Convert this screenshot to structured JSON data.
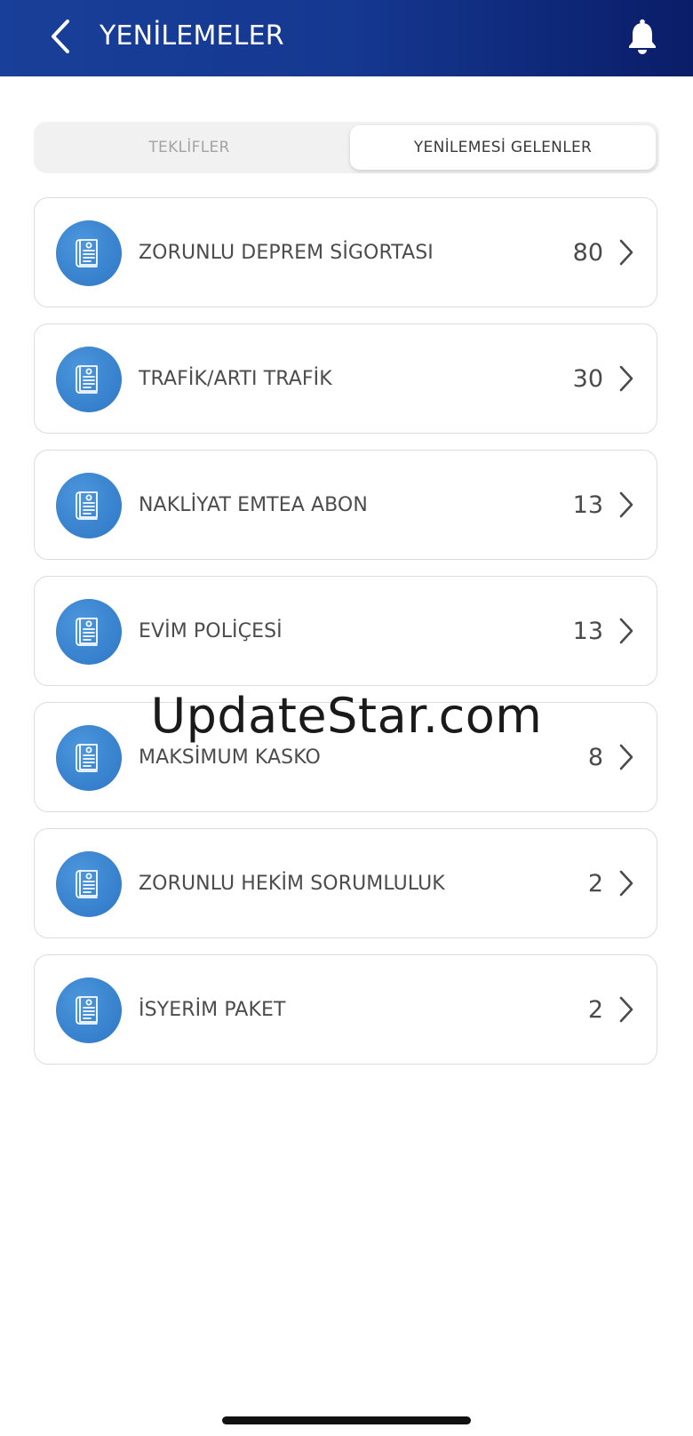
{
  "header": {
    "title": "YENİLEMELER",
    "back_icon": "chevron-left-icon",
    "bell_icon": "bell-icon",
    "background": "#163a92"
  },
  "tabs": [
    {
      "label": "TEKLİFLER",
      "active": false
    },
    {
      "label": "YENİLEMESİ GELENLER",
      "active": true
    }
  ],
  "items": [
    {
      "label": "ZORUNLU DEPREM SİGORTASI",
      "count": "80"
    },
    {
      "label": "TRAFİK/ARTI TRAFİK",
      "count": "30"
    },
    {
      "label": "NAKLİYAT EMTEA ABON",
      "count": "13"
    },
    {
      "label": "EVİM POLİÇESİ",
      "count": "13"
    },
    {
      "label": "MAKSİMUM KASKO",
      "count": "8"
    },
    {
      "label": "ZORUNLU HEKİM SORUMLULUK",
      "count": "2"
    },
    {
      "label": "İSYERİM PAKET",
      "count": "2"
    }
  ],
  "item_icon": "document-icon",
  "accent_color": "#3a84d0",
  "watermark": "UpdateStar.com"
}
